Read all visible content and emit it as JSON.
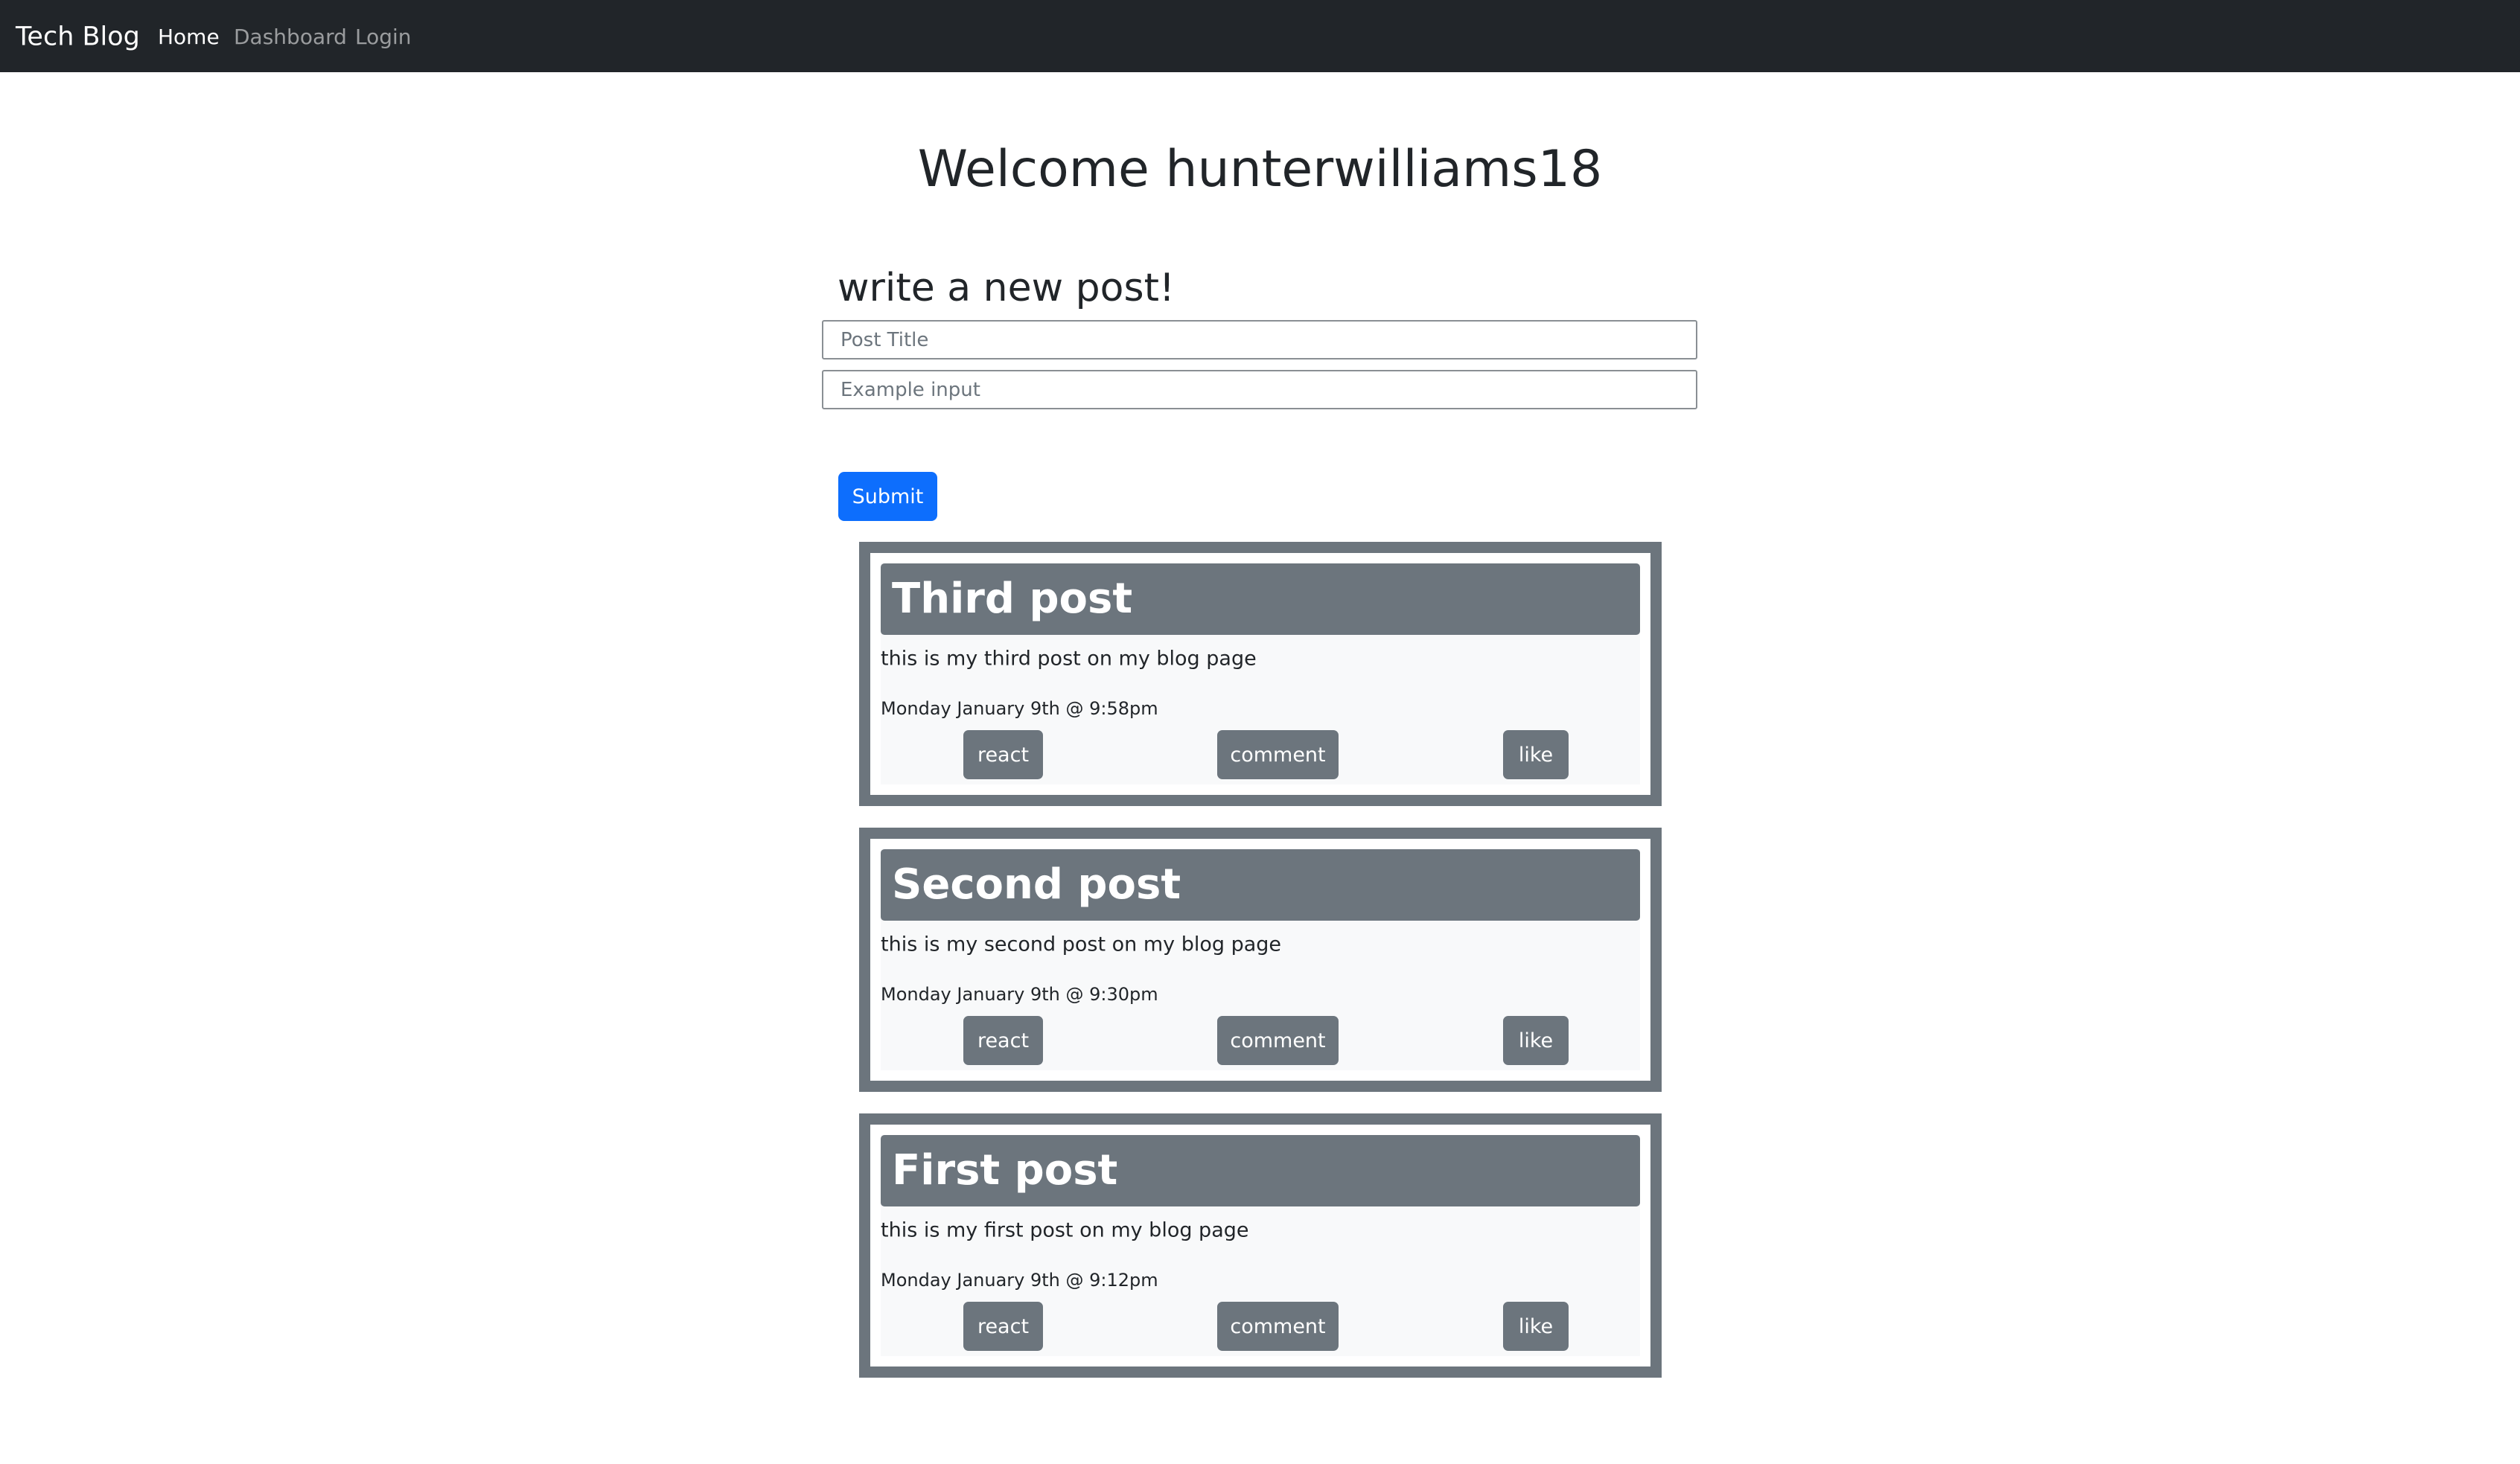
{
  "navbar": {
    "brand": "Tech Blog",
    "links": [
      {
        "label": "Home",
        "active": true
      },
      {
        "label": "Dashboard",
        "active": false
      },
      {
        "label": "Login",
        "active": false
      }
    ]
  },
  "welcome": "Welcome hunterwilliams18",
  "form": {
    "heading": "write a new post!",
    "title_placeholder": "Post Title",
    "title_value": "",
    "body_placeholder": "Example input",
    "body_value": "",
    "submit_label": "Submit"
  },
  "posts": [
    {
      "title": "Third post",
      "body": "this is my third post on my blog page",
      "date": "Monday January 9th @ 9:58pm",
      "buttons": {
        "react": "react",
        "comment": "comment",
        "like": "like"
      }
    },
    {
      "title": "Second post",
      "body": "this is my second post on my blog page",
      "date": "Monday January 9th @ 9:30pm",
      "buttons": {
        "react": "react",
        "comment": "comment",
        "like": "like"
      }
    },
    {
      "title": "First post",
      "body": "this is my first post on my blog page",
      "date": "Monday January 9th @ 9:12pm",
      "buttons": {
        "react": "react",
        "comment": "comment",
        "like": "like"
      }
    }
  ],
  "colors": {
    "navbar_bg": "#212529",
    "primary": "#0d6efd",
    "secondary": "#6c757d",
    "card_bg": "#f8f9fa"
  }
}
